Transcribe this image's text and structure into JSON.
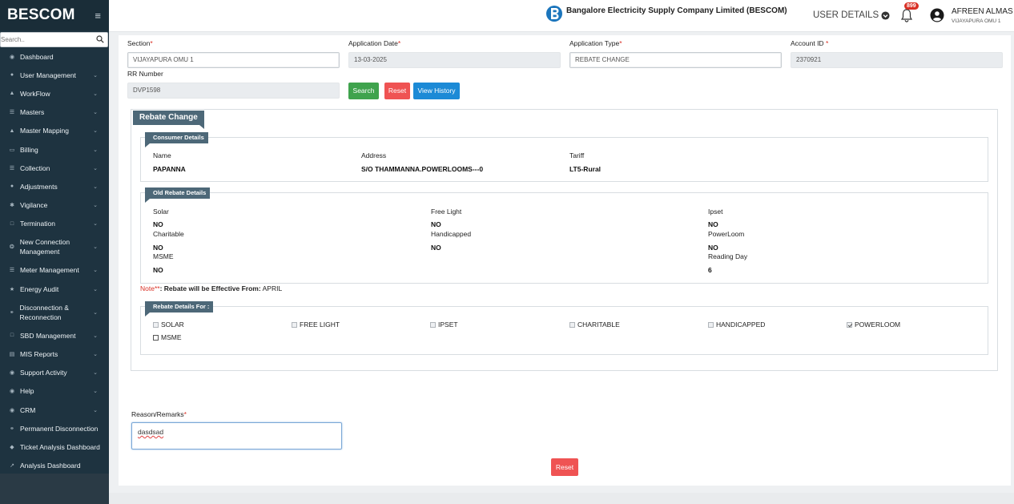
{
  "brand": {
    "name": "BESCOM"
  },
  "sidebar": {
    "search_placeholder": "Search..",
    "items": [
      {
        "label": "Dashboard",
        "icon": "dashboard-icon",
        "chevron": false
      },
      {
        "label": "User Management",
        "icon": "user-icon",
        "chevron": true
      },
      {
        "label": "WorkFlow",
        "icon": "workflow-icon",
        "chevron": true
      },
      {
        "label": "Masters",
        "icon": "list-icon",
        "chevron": true
      },
      {
        "label": "Master Mapping",
        "icon": "sitemap-icon",
        "chevron": true
      },
      {
        "label": "Billing",
        "icon": "monitor-icon",
        "chevron": true
      },
      {
        "label": "Collection",
        "icon": "list-icon",
        "chevron": true
      },
      {
        "label": "Adjustments",
        "icon": "users-icon",
        "chevron": true
      },
      {
        "label": "Vigilance",
        "icon": "eye-icon",
        "chevron": true
      },
      {
        "label": "Termination",
        "icon": "file-icon",
        "chevron": true
      },
      {
        "label": "New Connection Management",
        "icon": "plug-icon",
        "chevron": true
      },
      {
        "label": "Meter Management",
        "icon": "meter-icon",
        "chevron": true
      },
      {
        "label": "Energy Audit",
        "icon": "audit-icon",
        "chevron": true
      },
      {
        "label": "Disconnection & Reconnection",
        "icon": "link-icon",
        "chevron": true
      },
      {
        "label": "SBD Management",
        "icon": "doc-icon",
        "chevron": true
      },
      {
        "label": "MIS Reports",
        "icon": "chart-icon",
        "chevron": true
      },
      {
        "label": "Support Activity",
        "icon": "support-icon",
        "chevron": true
      },
      {
        "label": "Help",
        "icon": "help-icon",
        "chevron": true
      },
      {
        "label": "CRM",
        "icon": "crm-icon",
        "chevron": true
      },
      {
        "label": "Permanent Disconnection",
        "icon": "disconnect-icon",
        "chevron": false
      },
      {
        "label": "Ticket Analysis Dashboard",
        "icon": "ticket-icon",
        "chevron": false
      },
      {
        "label": "Analysis Dashboard",
        "icon": "line-chart-icon",
        "chevron": false
      }
    ]
  },
  "topbar": {
    "company": "Bangalore Electricity Supply Company Limited (BESCOM)",
    "user_details": "USER DETAILS",
    "notification_count": "899",
    "user_name": "AFREEN ALMAS",
    "user_office": "VIJAYAPURA OMU 1"
  },
  "form": {
    "section_label": "Section",
    "section_value": "VIJAYAPURA OMU 1",
    "app_date_label": "Application Date",
    "app_date_value": "13-03-2025",
    "app_type_label": "Application Type",
    "app_type_value": "REBATE CHANGE",
    "account_label": "Account ID",
    "account_value": "2370921",
    "rr_label": "RR Number",
    "rr_value": "DVP1598",
    "search_btn": "Search",
    "reset_btn": "Reset",
    "history_btn": "View History"
  },
  "rebate": {
    "title": "Rebate Change",
    "consumer": {
      "title": "Consumer Details",
      "name_label": "Name",
      "name_value": "PAPANNA",
      "address_label": "Address",
      "address_value": "S/O THAMMANNA.POWERLOOMS---0",
      "tariff_label": "Tariff",
      "tariff_value": "LT5-Rural"
    },
    "old": {
      "title": "Old Rebate Details",
      "solar_label": "Solar",
      "solar_value": "NO",
      "free_light_label": "Free Light",
      "free_light_value": "NO",
      "ipset_label": "Ipset",
      "ipset_value": "NO",
      "charitable_label": "Charitable",
      "charitable_value": "NO",
      "handicapped_label": "Handicapped",
      "handicapped_value": "NO",
      "powerloom_label": "PowerLoom",
      "powerloom_value": "NO",
      "msme_label": "MSME",
      "msme_value": "NO",
      "reading_day_label": "Reading Day",
      "reading_day_value": "6"
    },
    "note_key": "Note**",
    "note_text": ": Rebate will be Effective From:",
    "note_month": "APRIL",
    "for": {
      "title": "Rebate Details For :",
      "options": [
        {
          "label": "SOLAR",
          "checked": false
        },
        {
          "label": "FREE LIGHT",
          "checked": false
        },
        {
          "label": "IPSET",
          "checked": false
        },
        {
          "label": "CHARITABLE",
          "checked": false
        },
        {
          "label": "HANDICAPPED",
          "checked": false
        },
        {
          "label": "POWERLOOM",
          "checked": true
        },
        {
          "label": "MSME",
          "checked": false
        }
      ]
    }
  },
  "remarks": {
    "label": "Reason/Remarks",
    "value": "dasdsad"
  },
  "bottom_reset": "Reset"
}
